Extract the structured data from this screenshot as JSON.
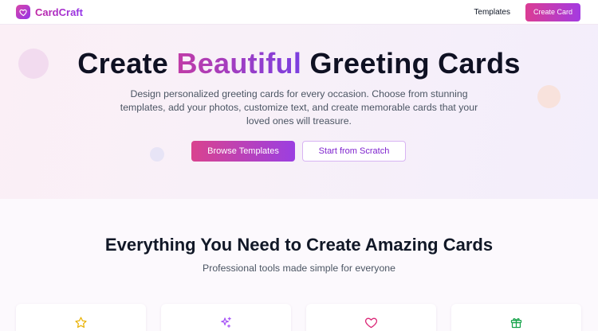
{
  "nav": {
    "brand": "CardCraft",
    "links": [
      "Templates"
    ],
    "cta": "Create Card"
  },
  "hero": {
    "title_pre": "Create ",
    "title_accent": "Beautiful",
    "title_post": " Greeting Cards",
    "subtitle": "Design personalized greeting cards for every occasion. Choose from stunning templates, add your photos, customize text, and create memorable cards that your loved ones will treasure.",
    "primary_button": "Browse Templates",
    "secondary_button": "Start from Scratch"
  },
  "features": {
    "title": "Everything You Need to Create Amazing Cards",
    "subtitle": "Professional tools made simple for everyone",
    "cards": [
      {
        "icon": "star-icon",
        "color": "#eab308"
      },
      {
        "icon": "sparkles-icon",
        "color": "#a855f7"
      },
      {
        "icon": "heart-icon",
        "color": "#db2777"
      },
      {
        "icon": "gift-icon",
        "color": "#16a34a"
      }
    ]
  },
  "colors": {
    "brand_pink": "#db2777",
    "brand_purple": "#9333ea"
  }
}
